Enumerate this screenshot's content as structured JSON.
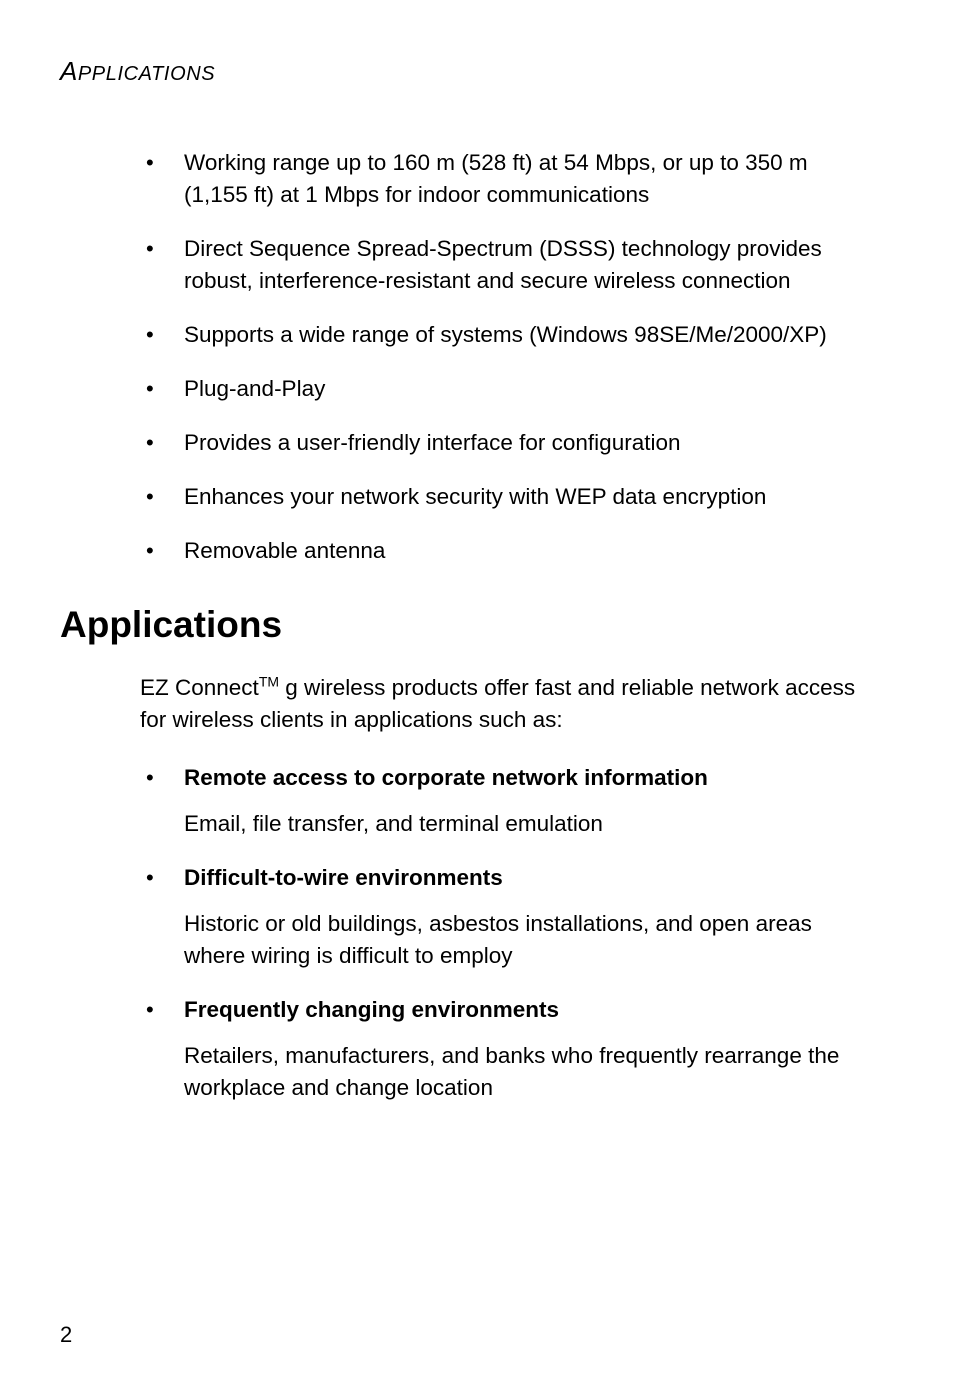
{
  "header": {
    "first_char": "A",
    "rest": "PPLICATIONS"
  },
  "features": [
    "Working range up to 160 m (528 ft) at 54 Mbps, or up to 350 m (1,155 ft) at 1 Mbps for indoor communications",
    "Direct Sequence Spread-Spectrum (DSSS) technology provides robust, interference-resistant and secure wireless connection",
    "Supports a wide range of systems (Windows 98SE/Me/2000/XP)",
    "Plug-and-Play",
    "Provides a user-friendly interface for configuration",
    "Enhances your network security with WEP data encryption",
    "Removable antenna"
  ],
  "section_title": "Applications",
  "intro": {
    "prefix": "EZ Connect",
    "tm": "TM",
    "suffix": " g wireless products offer fast and reliable network access for wireless clients in applications such as:"
  },
  "apps": [
    {
      "title": "Remote access to corporate network information",
      "desc": "Email, file transfer, and terminal emulation"
    },
    {
      "title": "Difficult-to-wire environments",
      "desc": "Historic or old buildings, asbestos installations, and open areas where wiring is difficult to employ"
    },
    {
      "title": "Frequently changing environments",
      "desc": "Retailers, manufacturers, and banks who frequently rearrange the workplace and change location"
    }
  ],
  "page_number": "2"
}
